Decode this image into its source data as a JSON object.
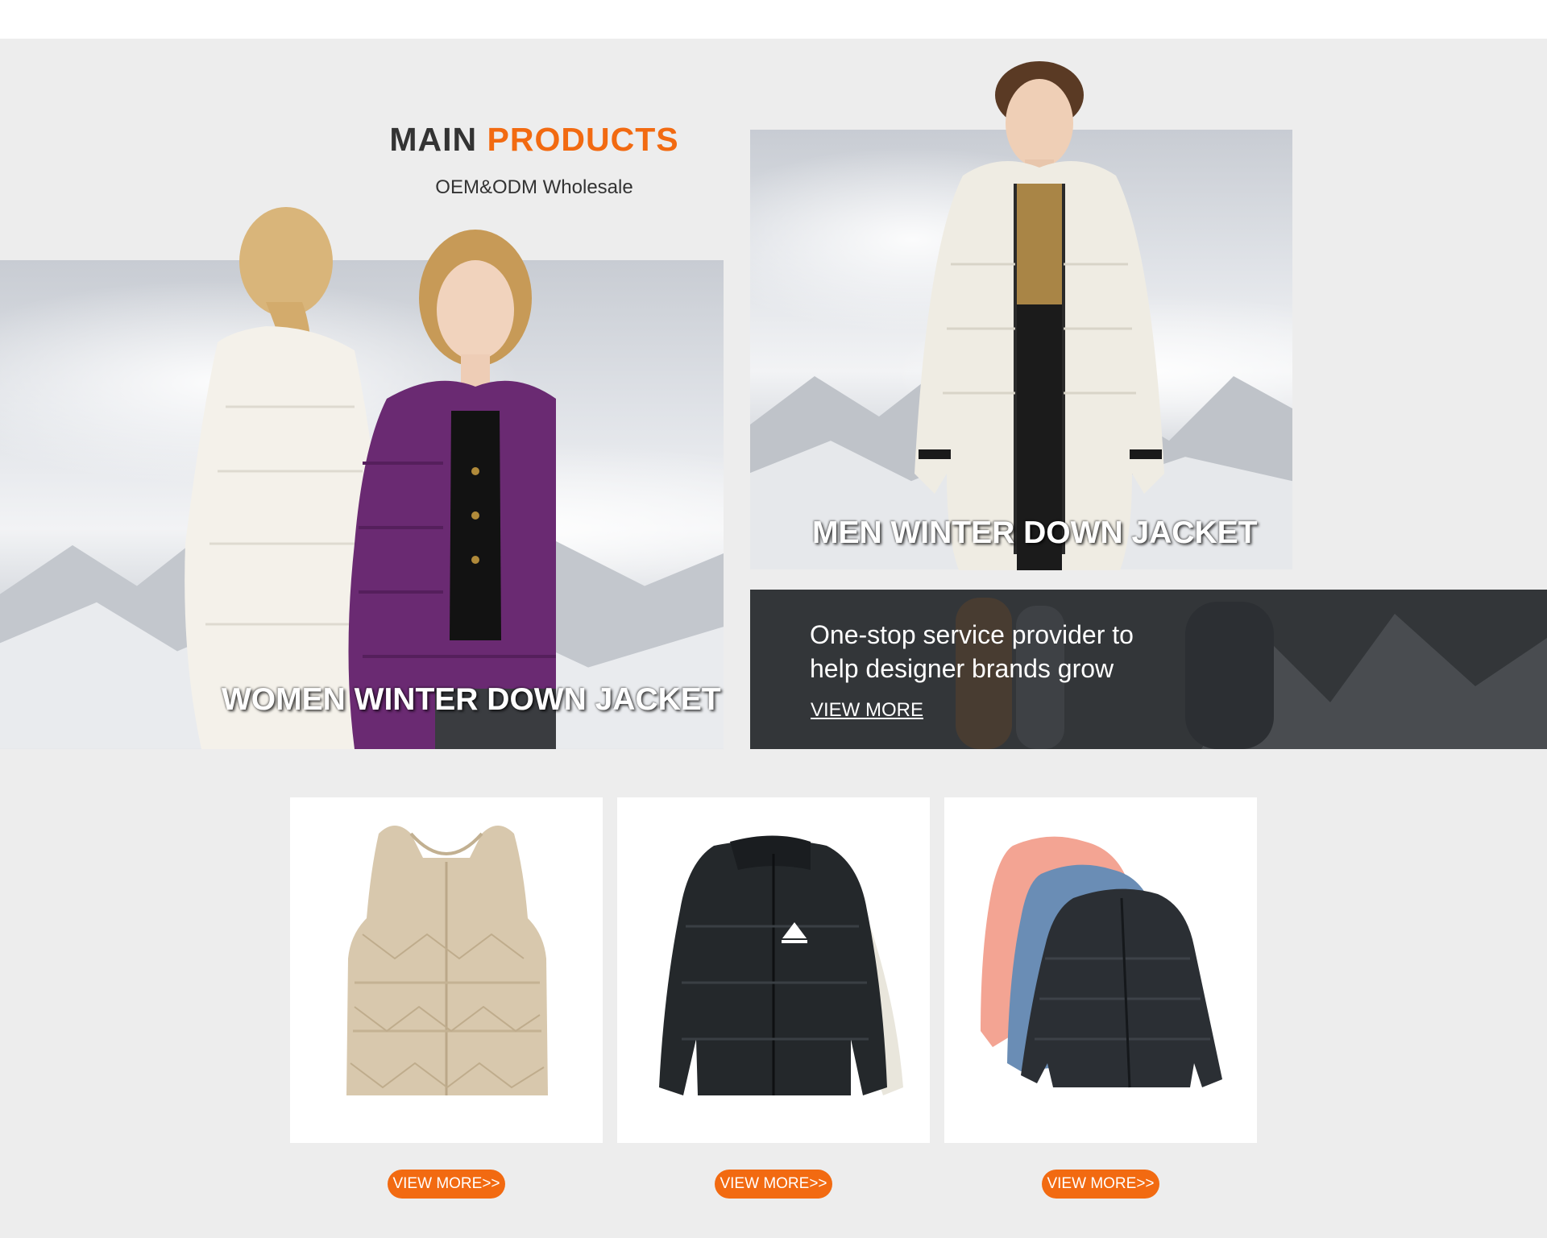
{
  "header": {
    "title_part1": "MAIN ",
    "title_part2": "PRODUCTS",
    "subtitle": "OEM&ODM Wholesale"
  },
  "heroes": {
    "women": {
      "caption": "WOMEN WINTER DOWN JACKET"
    },
    "men": {
      "caption": "MEN WINTER DOWN JACKET"
    }
  },
  "promo": {
    "line1": "One-stop service provider to",
    "line2": "help designer brands grow",
    "link": "VIEW MORE"
  },
  "products": [
    {
      "image": "beige-quilted-vest",
      "button": "VIEW MORE>>"
    },
    {
      "image": "black-puffer-jacket",
      "button": "VIEW MORE>>"
    },
    {
      "image": "pink-blue-black-puffer-jackets",
      "button": "VIEW MORE>>"
    }
  ],
  "colors": {
    "accent": "#f26a11",
    "background": "#ededed",
    "title_text": "#333333"
  }
}
